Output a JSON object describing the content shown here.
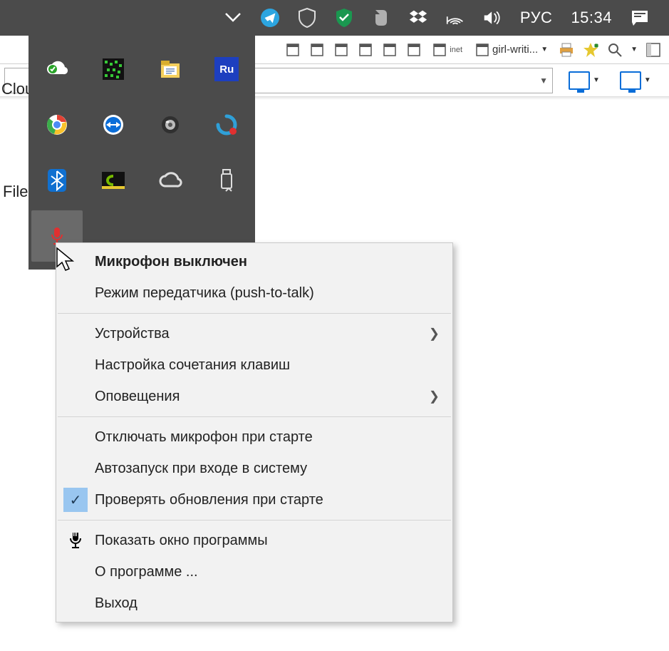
{
  "taskbar": {
    "language": "РУС",
    "time": "15:34"
  },
  "toolbar": {
    "doc_tab_label": "girl-writi...",
    "inet_label": "inet"
  },
  "urlbar": {
    "value": "Clou"
  },
  "background": {
    "peek_left_1": "File",
    "peek_left_2": "Clou"
  },
  "tray_icons": {
    "r1c1": "cloud-sync-icon",
    "r1c2": "greenshot-icon",
    "r1c3": "folder-icon",
    "r1c4": "adobe-ru-icon",
    "r2c1": "chrome-icon",
    "r2c2": "teamviewer-icon",
    "r2c3": "speaker-icon",
    "r2c4": "recorder-icon",
    "r3c1": "bluetooth-icon",
    "r3c2": "nvidia-icon",
    "r3c3": "creative-cloud-icon",
    "r3c4": "usb-device-icon",
    "r4c1": "microphone-muted-icon"
  },
  "context_menu": {
    "items": [
      {
        "label": "Микрофон выключен",
        "bold": true
      },
      {
        "label": "Режим передатчика (push-to-talk)"
      },
      {
        "sep": true
      },
      {
        "label": "Устройства",
        "submenu": true
      },
      {
        "label": "Настройка сочетания клавиш"
      },
      {
        "label": "Оповещения",
        "submenu": true
      },
      {
        "sep": true
      },
      {
        "label": "Отключать микрофон при старте"
      },
      {
        "label": "Автозапуск при входе в систему"
      },
      {
        "label": "Проверять обновления при старте",
        "checked": true
      },
      {
        "sep": true
      },
      {
        "label": "Показать окно программы",
        "icon": "mic"
      },
      {
        "label": "О программе ..."
      },
      {
        "label": "Выход"
      }
    ]
  }
}
